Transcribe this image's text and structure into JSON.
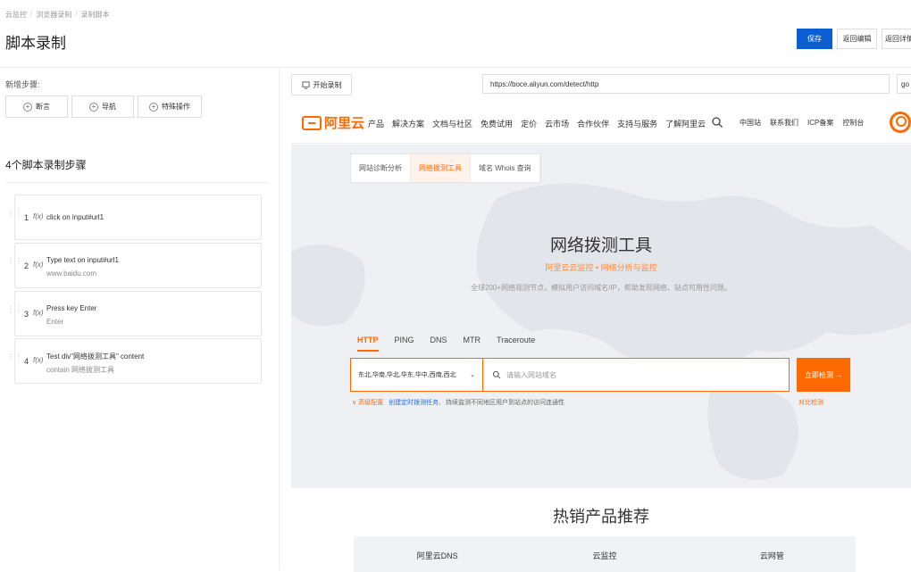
{
  "header": {
    "breadcrumb": [
      "云监控",
      "浏览器录制",
      "录制脚本"
    ],
    "title": "脚本录制",
    "buttons": {
      "save": "保存",
      "back_edit": "返回编辑",
      "back_detail": "返回详情"
    }
  },
  "left": {
    "add_label": "新增步骤:",
    "add_buttons": [
      "断言",
      "导航",
      "特殊操作"
    ],
    "count_title": "4个脚本录制步骤",
    "steps": [
      {
        "num": "1",
        "fx": "f(x)",
        "main": "click on input#url1",
        "sub": ""
      },
      {
        "num": "2",
        "fx": "f(x)",
        "main": "Type text on input#url1",
        "sub": "www.baidu.com"
      },
      {
        "num": "3",
        "fx": "f(x)",
        "main": "Press key Enter",
        "sub": "Enter"
      },
      {
        "num": "4",
        "fx": "f(x)",
        "main": "Test div\"网络拨测工具\" content",
        "sub": "contain 网络拨测工具"
      }
    ]
  },
  "browser": {
    "record_button": "开始录制",
    "url": "https://boce.aliyun.com/detect/http",
    "go": "go t",
    "logo_text": "阿里云",
    "nav_items": [
      "产品",
      "解决方案",
      "文档与社区",
      "免费试用",
      "定价",
      "云市场",
      "合作伙伴",
      "支持与服务",
      "了解阿里云"
    ],
    "nav_right": [
      "中国站",
      "联系我们",
      "ICP备案",
      "控制台"
    ],
    "tabs": [
      "网站诊断分析",
      "网络拨测工具",
      "域名 Whois 查询"
    ],
    "hero_title": "网络拨测工具",
    "hero_sub": "阿里云云监控 • 网络分析与监控",
    "hero_desc": "全球200+网络观测节点，模拟用户访问域名/IP，帮助发现网络、站点可用性问题。",
    "protocol_tabs": [
      "HTTP",
      "PING",
      "DNS",
      "MTR",
      "Traceroute"
    ],
    "region_value": "东北,华南,华北,华东,华中,西南,西北",
    "search_placeholder": "请输入网站域名",
    "search_button": "立即检测 →",
    "adv_settings": "∨ 高级配置",
    "adv_link": "创建定时拨测任务,",
    "adv_text": "持续监测不同地区用户到站点的访问连通性",
    "compare": "对比检测",
    "hot_title": "热销产品推荐",
    "products": [
      "阿里云DNS",
      "云监控",
      "云网管"
    ]
  }
}
